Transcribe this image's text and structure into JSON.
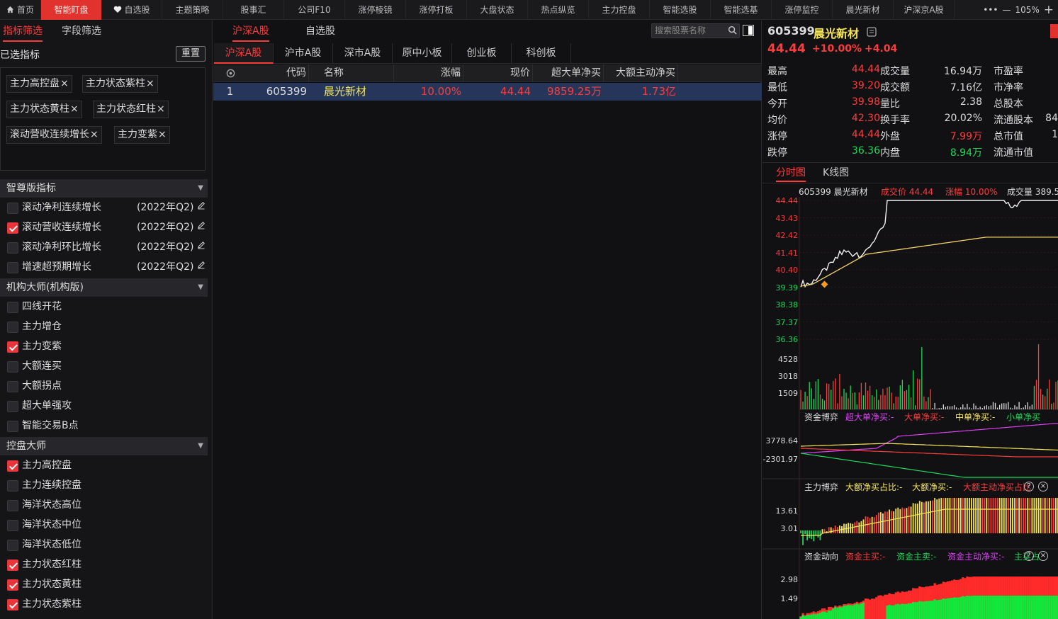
{
  "nav": {
    "items": [
      "首页",
      "智能盯盘",
      "自选股",
      "主题策略",
      "股事汇",
      "公司F10",
      "涨停棱镜",
      "涨停打板",
      "大盘状态",
      "热点纵览",
      "主力控盘",
      "智能选股",
      "智能选基",
      "涨停监控",
      "晨光新材",
      "沪深京A股"
    ],
    "active": "智能盯盘",
    "more": "•••",
    "minus": "—",
    "zoom": "105%",
    "plus": "+"
  },
  "left": {
    "tabs": [
      "指标筛选",
      "字段筛选"
    ],
    "selected_label": "已选指标",
    "reset": "重置",
    "chips": [
      "主力高控盘",
      "主力状态紫柱",
      "主力状态黄柱",
      "主力状态红柱",
      "滚动营收连续增长",
      "主力变紫"
    ],
    "chip_close": "×",
    "sections": [
      {
        "title": "智尊版指标",
        "items": [
          {
            "label": "滚动净利连续增长",
            "checked": false,
            "period": "(2022年Q2)"
          },
          {
            "label": "滚动营收连续增长",
            "checked": true,
            "period": "(2022年Q2)"
          },
          {
            "label": "滚动净利环比增长",
            "checked": false,
            "period": "(2022年Q2)"
          },
          {
            "label": "增速超预期增长",
            "checked": false,
            "period": "(2022年Q2)"
          }
        ]
      },
      {
        "title": "机构大师(机构版)",
        "items": [
          {
            "label": "四线开花",
            "checked": false
          },
          {
            "label": "主力增仓",
            "checked": false
          },
          {
            "label": "主力变紫",
            "checked": true
          },
          {
            "label": "大额连买",
            "checked": false
          },
          {
            "label": "大额拐点",
            "checked": false
          },
          {
            "label": "超大单强攻",
            "checked": false
          },
          {
            "label": "智能交易B点",
            "checked": false
          }
        ]
      },
      {
        "title": "控盘大师",
        "items": [
          {
            "label": "主力高控盘",
            "checked": true
          },
          {
            "label": "主力连续控盘",
            "checked": false
          },
          {
            "label": "海洋状态高位",
            "checked": false
          },
          {
            "label": "海洋状态中位",
            "checked": false
          },
          {
            "label": "海洋状态低位",
            "checked": false
          },
          {
            "label": "主力状态红柱",
            "checked": true
          },
          {
            "label": "主力状态黄柱",
            "checked": true
          },
          {
            "label": "主力状态紫柱",
            "checked": true
          }
        ]
      }
    ]
  },
  "mid": {
    "tabs": [
      "沪深A股",
      "自选股"
    ],
    "search_placeholder": "搜索股票名称",
    "subtabs": [
      "沪深A股",
      "沪市A股",
      "深市A股",
      "原中小板",
      "创业板",
      "科创板"
    ],
    "columns": [
      "代码",
      "名称",
      "涨幅",
      "现价",
      "超大单净买",
      "大额主动净买"
    ],
    "rows": [
      {
        "idx": "1",
        "code": "605399",
        "name": "晨光新材",
        "change": "10.00%",
        "price": "44.44",
        "super_net": "9859.25万",
        "big_net": "1.73亿"
      }
    ]
  },
  "quote": {
    "code": "605399",
    "name": "晨光新材",
    "price": "44.44",
    "pct": "+10.00%",
    "chg": "+4.04",
    "col1": [
      {
        "label": "最高",
        "value": "44.44",
        "color": "red"
      },
      {
        "label": "最低",
        "value": "39.20",
        "color": "red"
      },
      {
        "label": "今开",
        "value": "39.98",
        "color": "red"
      },
      {
        "label": "均价",
        "value": "42.30",
        "color": "red"
      },
      {
        "label": "涨停",
        "value": "44.44",
        "color": "red"
      },
      {
        "label": "跌停",
        "value": "36.36",
        "color": "green"
      }
    ],
    "col2": [
      {
        "label": "成交量",
        "value": "16.94万",
        "color": "white"
      },
      {
        "label": "成交额",
        "value": "7.16亿",
        "color": "white"
      },
      {
        "label": "量比",
        "value": "2.38",
        "color": "white"
      },
      {
        "label": "换手率",
        "value": "20.02%",
        "color": "white"
      },
      {
        "label": "外盘",
        "value": "7.99万",
        "color": "red"
      },
      {
        "label": "内盘",
        "value": "8.94万",
        "color": "green"
      }
    ],
    "col3": [
      {
        "label": "市盈率",
        "value": ""
      },
      {
        "label": "市净率",
        "value": ""
      },
      {
        "label": "总股本",
        "value": ""
      },
      {
        "label": "流通股本",
        "value": "84"
      },
      {
        "label": "总市值",
        "value": "1"
      },
      {
        "label": "流通市值",
        "value": ""
      }
    ]
  },
  "chart": {
    "tabs": [
      "分时图",
      "K线图"
    ],
    "info": {
      "code_name": "605399 晨光新材",
      "price_label": "成交价 44.44",
      "pct_label": "涨幅 10.00%",
      "vol_label": "成交量 389.5"
    },
    "price_ticks": [
      "44.44",
      "43.43",
      "42.42",
      "41.41",
      "40.40",
      "39.39",
      "38.38",
      "37.37",
      "36.36"
    ],
    "vol_ticks": [
      "4528",
      "3018",
      "1509"
    ],
    "panels": [
      {
        "title": "资金博弈",
        "legend": [
          {
            "t": "超大单净买:-",
            "c": "#e040fb"
          },
          {
            "t": "大单净买:-",
            "c": "#ff3b3b"
          },
          {
            "t": "中单净买:-",
            "c": "#f7e65a"
          },
          {
            "t": "小单净买",
            "c": "#1fd85a"
          }
        ],
        "ticks": [
          "3778.64",
          "-2301.97"
        ]
      },
      {
        "title": "主力博弈",
        "legend": [
          {
            "t": "大额净买占比:-",
            "c": "#f7e65a"
          },
          {
            "t": "大额净买:-",
            "c": "#f7e65a"
          },
          {
            "t": "大额主动净买占比",
            "c": "#ff3b3b"
          }
        ],
        "ticks": [
          "13.61",
          "3.01"
        ]
      },
      {
        "title": "资金动向",
        "legend": [
          {
            "t": "资金主买:-",
            "c": "#ff3b3b"
          },
          {
            "t": "资金主卖:-",
            "c": "#1fd85a"
          },
          {
            "t": "资金主动净买:-",
            "c": "#e040fb"
          },
          {
            "t": "主买占",
            "c": "#1fd85a"
          }
        ],
        "ticks": [
          "2.98",
          "1.49"
        ]
      }
    ]
  }
}
